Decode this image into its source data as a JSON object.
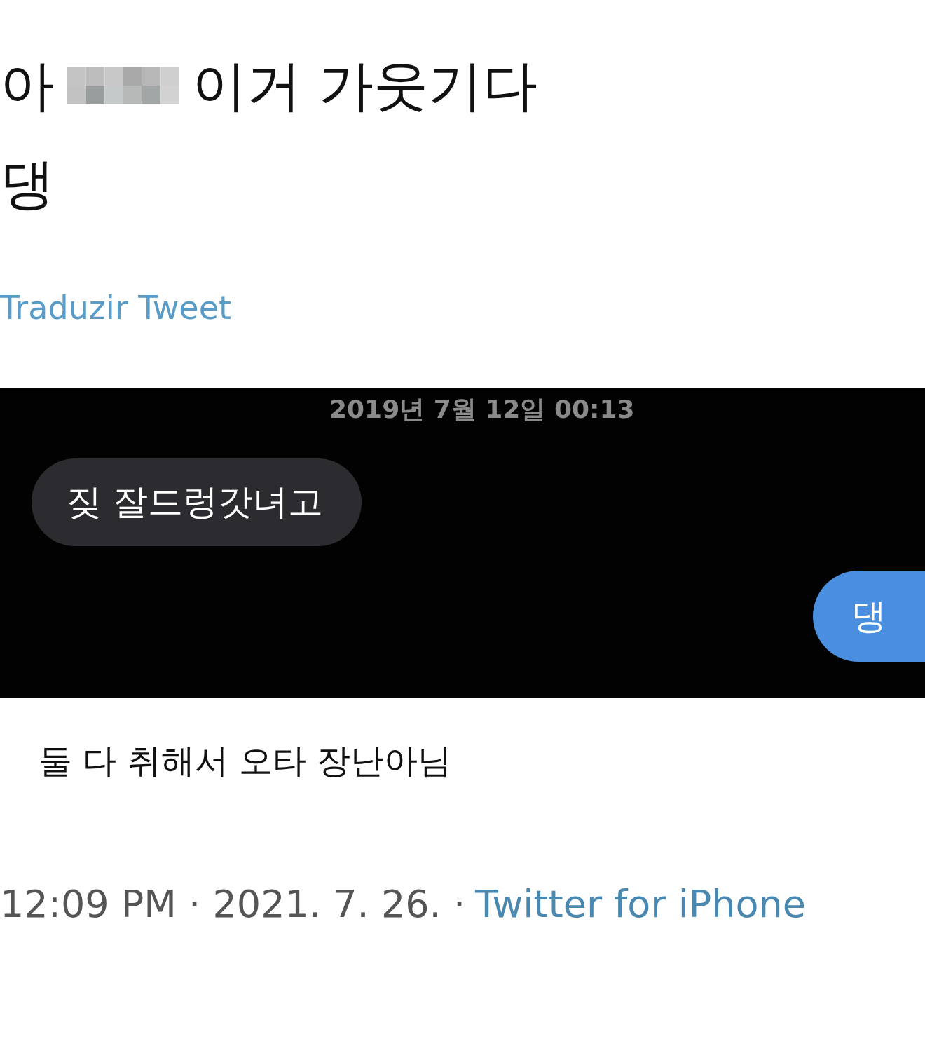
{
  "tweet": {
    "text_before": "아",
    "censored": true,
    "text_after": "이거 가웃기다",
    "second_line": "댕"
  },
  "translate_link": "Traduzir Tweet",
  "media": {
    "timestamp": "2019년 7월 12일 00:13",
    "messages": [
      {
        "kind": "received",
        "text": "짖 잘드렁갓녀고"
      },
      {
        "kind": "sent",
        "text": "댕"
      }
    ]
  },
  "caption": "둘 다 취해서 오타 장난아님",
  "meta": {
    "time_date": "12:09 PM · 2021. 7. 26. ·",
    "source": "Twitter for iPhone"
  }
}
